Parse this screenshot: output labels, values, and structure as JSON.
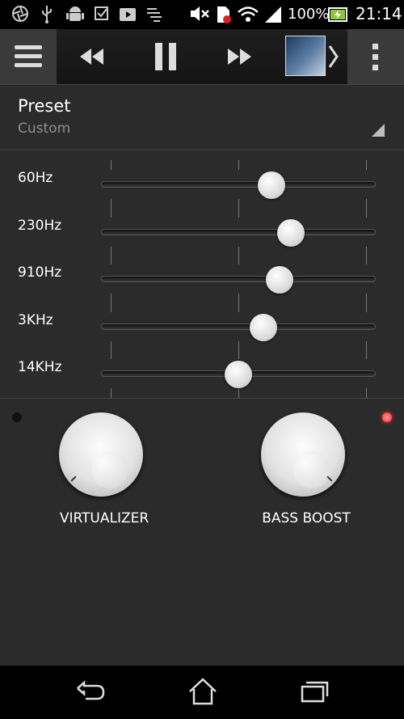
{
  "status_bar": {
    "battery_percent": "100%",
    "time": "21:14",
    "icons": [
      "aperture-icon",
      "usb-icon",
      "android-icon",
      "checkbox-icon",
      "play-store-icon",
      "sync-icon",
      "mute-icon",
      "sim-icon",
      "wifi-icon",
      "signal-icon",
      "battery-charging-icon"
    ]
  },
  "toolbar": {
    "icons": [
      "menu-icon",
      "rewind-icon",
      "pause-icon",
      "fast-forward-icon",
      "album-art",
      "chevron-right-icon",
      "overflow-menu-icon"
    ]
  },
  "preset": {
    "title": "Preset",
    "value": "Custom"
  },
  "equalizer": {
    "bands": [
      {
        "label": "60Hz",
        "level": 0.62
      },
      {
        "label": "230Hz",
        "level": 0.69
      },
      {
        "label": "910Hz",
        "level": 0.65
      },
      {
        "label": "3KHz",
        "level": 0.59
      },
      {
        "label": "14KHz",
        "level": 0.5
      }
    ]
  },
  "effects": {
    "virtualizer": {
      "label": "VIRTUALIZER",
      "led_on": false
    },
    "bass_boost": {
      "label": "BASS BOOST",
      "led_on": true
    }
  },
  "navigation": {
    "icons": [
      "back-icon",
      "home-icon",
      "recent-apps-icon"
    ]
  },
  "colors": {
    "background": "#2b2b2b",
    "led_on": "#ff2a2a",
    "led_off": "#111111",
    "secondary_text": "#8f8f8f"
  }
}
